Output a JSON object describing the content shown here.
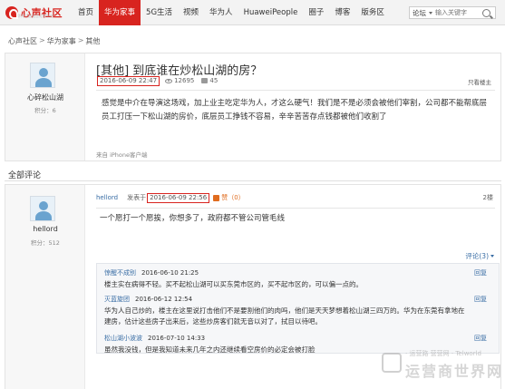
{
  "topbar": {
    "logo_text": "心声社区",
    "logo_sub": "华为人自由言论的平台",
    "nav": [
      "首页",
      "华为家事",
      "5G生活",
      "视频",
      "华为人",
      "HuaweiPeople",
      "圈子",
      "博客",
      "版务区"
    ],
    "active_nav_index": 1,
    "search_scope": "论坛",
    "search_placeholder": "输入关键字"
  },
  "breadcrumb": [
    "心声社区",
    "华为家事",
    "其他"
  ],
  "post": {
    "author": "心碎松山湖",
    "author_score": "积分：6",
    "title": "[其他] 到底谁在炒松山湖的房？",
    "timestamp": "2016-06-09 22:47",
    "views": "12695",
    "comments": "45",
    "only_author": "只看楼主",
    "body": "感觉是中介在导演这场戏，加上业主吃定华为人，才这么硬气！我们是不是必须会被他们宰割，公司都不能帮底层员工打压一下松山湖的房价，底层员工挣钱不容易，辛辛苦苦存点钱都被他们收割了",
    "from": "来自 iPhone客户端"
  },
  "all_comments_label": "全部评论",
  "reply": {
    "author": "hellord",
    "author_score": "积分：512",
    "posted_label": "发表于",
    "timestamp": "2016-06-09 22:56",
    "like_label": "赞（0）",
    "floor": "2楼",
    "text": "一个愿打一个愿挨，你想多了，政府都不管公司管毛线",
    "comment_link": "评论(3)",
    "sub_comments": [
      {
        "user": "惊醒不成别",
        "time": "2016-06-10 21:25",
        "text": "楼主实在病得不轻。买不起松山湖可以买东莞市区的，买不起市区的，可以偏一点的。",
        "reply": "回复"
      },
      {
        "user": "灭蓝旋团",
        "time": "2016-06-12 12:54",
        "text": "华为人自己炒的，楼主在这里说打击他们不是要割他们的肉吗，他们是天天梦想着松山湖三四万的。华为在东莞有拿地在建房，估计这些房子出来后，这些炒房客们就无音以对了，拭目以待吧。",
        "reply": "回复"
      },
      {
        "user": "松山湖小波波",
        "time": "2016-07-10 14:33",
        "text": "虽然我没钱，但是我知道未来几年之内还继续看空房价的必定会被打脸",
        "reply": "回复"
      }
    ]
  },
  "watermark": {
    "top": "· 运营路 营营网 · Telworld",
    "big": "运营商世界网"
  },
  "colors": {
    "brand": "#d8241f",
    "link": "#3a6ea5",
    "like": "#e06c1f"
  }
}
